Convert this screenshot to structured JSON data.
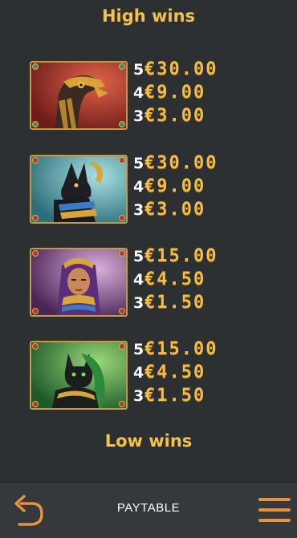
{
  "sections": {
    "high_title": "High wins",
    "low_title": "Low wins"
  },
  "symbols": [
    {
      "name": "horus-falcon",
      "pays": [
        {
          "count": "5",
          "value": "€30.00"
        },
        {
          "count": "4",
          "value": "€9.00"
        },
        {
          "count": "3",
          "value": "€3.00"
        }
      ]
    },
    {
      "name": "anubis-jackal",
      "pays": [
        {
          "count": "5",
          "value": "€30.00"
        },
        {
          "count": "4",
          "value": "€9.00"
        },
        {
          "count": "3",
          "value": "€3.00"
        }
      ]
    },
    {
      "name": "cleopatra-queen",
      "pays": [
        {
          "count": "5",
          "value": "€15.00"
        },
        {
          "count": "4",
          "value": "€4.50"
        },
        {
          "count": "3",
          "value": "€1.50"
        }
      ]
    },
    {
      "name": "bastet-cat",
      "pays": [
        {
          "count": "5",
          "value": "€15.00"
        },
        {
          "count": "4",
          "value": "€4.50"
        },
        {
          "count": "3",
          "value": "€1.50"
        }
      ]
    }
  ],
  "bottom_bar": {
    "title": "PAYTABLE",
    "back_icon": "undo-arrow-icon",
    "menu_icon": "hamburger-menu-icon"
  },
  "colors": {
    "background": "#2c3033",
    "title_gold": "#f4c14a",
    "value_gold": "#f2be45",
    "accent_orange": "#e8923b",
    "frame_gold": "#c99a3b"
  }
}
